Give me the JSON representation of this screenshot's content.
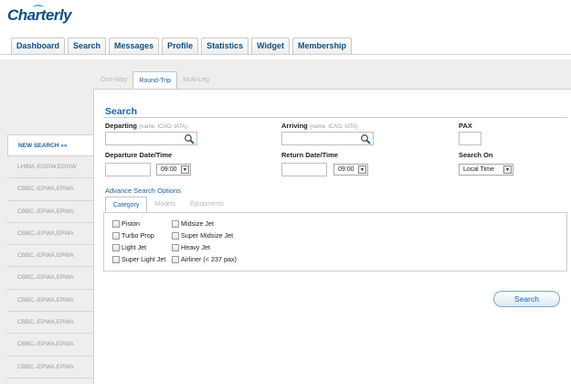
{
  "app": {
    "logo_text": "Charterly"
  },
  "nav": {
    "tabs": [
      "Dashboard",
      "Search",
      "Messages",
      "Profile",
      "Statistics",
      "Widget",
      "Membership"
    ]
  },
  "trip_tabs": {
    "one_way": "One-Way",
    "round_trip": "Round-Trip",
    "multi_leg": "Multi-Leg",
    "active": "Round-Trip"
  },
  "sidebar": {
    "new_search": "NEW SEARCH »»",
    "items": [
      "LHBM,-EGGW,EGGW",
      "CBBC,-EPWA,EPWA",
      "CBBC,-EPWA,EPWA",
      "CBBC,-EPWA,EPWA",
      "CBBC,-EPWA,EPWA",
      "CBBC,-EPWA,EPWA",
      "CBBC,-EPWA,EPWA",
      "CBBC,-EPWA,EPWA",
      "CBBC,-EPWA,EPWA",
      "CBBC,-EPWA,EPWA"
    ]
  },
  "form": {
    "title": "Search",
    "departing_label": "Departing",
    "departing_hint": "(name, ICAO, IATA)",
    "arriving_label": "Arriving",
    "arriving_hint": "(name, ICAO, IATA)",
    "pax_label": "PAX",
    "departure_label": "Departure Date/Time",
    "departure_time": "09:00",
    "return_label": "Return Date/Time",
    "return_time": "09:00",
    "search_on_label": "Search On",
    "search_on_value": "Local Time",
    "advance_link": "Advance Search Options",
    "search_button": "Search"
  },
  "categories": {
    "tabs": [
      "Category",
      "Models",
      "Equipments"
    ],
    "active": "Category",
    "col1": [
      "Piston",
      "Turbo Prop",
      "Light Jet",
      "Super Light Jet"
    ],
    "col2": [
      "Midsize Jet",
      "Super Midsize Jet",
      "Heavy Jet",
      "Airliner (< 237 pax)"
    ]
  },
  "colors": {
    "brand_blue": "#1b62a8",
    "logo_blue": "#0b4f87",
    "page_bg": "#eeeeee"
  }
}
